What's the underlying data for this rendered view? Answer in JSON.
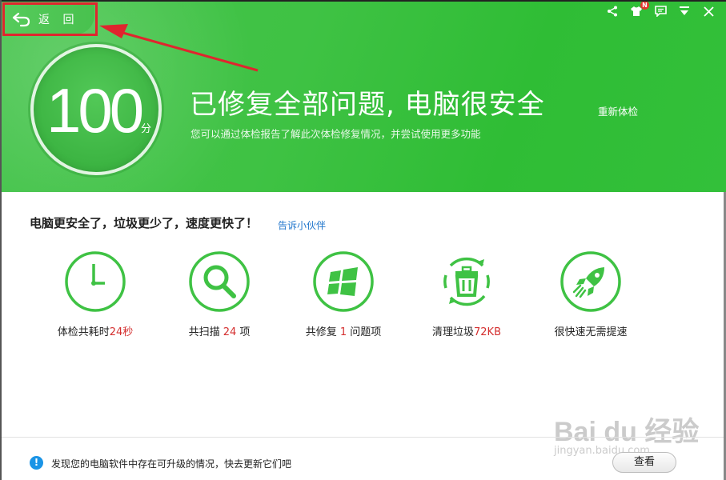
{
  "back": {
    "label": "返 回"
  },
  "window_controls": {
    "badge": "N",
    "icons": [
      "share-icon",
      "skin-icon",
      "feedback-icon",
      "menu-icon",
      "close-icon"
    ]
  },
  "score": {
    "value": "100",
    "unit": "分"
  },
  "header": {
    "headline": "已修复全部问题, 电脑很安全",
    "subline": "您可以通过体检报告了解此次体检修复情况，并尝试使用更多功能",
    "recheck_label": "重新体检"
  },
  "summary": {
    "text": "电脑更安全了，垃圾更少了，速度更快了！",
    "share_link": "告诉小伙伴"
  },
  "stats": [
    {
      "icon": "clock-icon",
      "prefix": "体检共耗时",
      "highlight": "24秒",
      "suffix": ""
    },
    {
      "icon": "magnifier-icon",
      "prefix": "共扫描 ",
      "highlight": "24",
      "suffix": " 项"
    },
    {
      "icon": "windows-icon",
      "prefix": "共修复 ",
      "highlight": "1",
      "suffix": " 问题项"
    },
    {
      "icon": "trash-icon",
      "prefix": "清理垃圾",
      "highlight": "72KB",
      "suffix": ""
    },
    {
      "icon": "rocket-icon",
      "prefix": "很快速无需提速",
      "highlight": "",
      "suffix": ""
    }
  ],
  "footer": {
    "message": "发现您的电脑软件中存在可升级的情况，快去更新它们吧",
    "button_label": "查看"
  },
  "watermark": {
    "text": "Bai du 经验",
    "sub": "jingyan.baidu.com"
  },
  "colors": {
    "green": "#3fc244",
    "accent_red": "#d42f2f",
    "link_blue": "#2277cc",
    "info_blue": "#1a94e6"
  }
}
